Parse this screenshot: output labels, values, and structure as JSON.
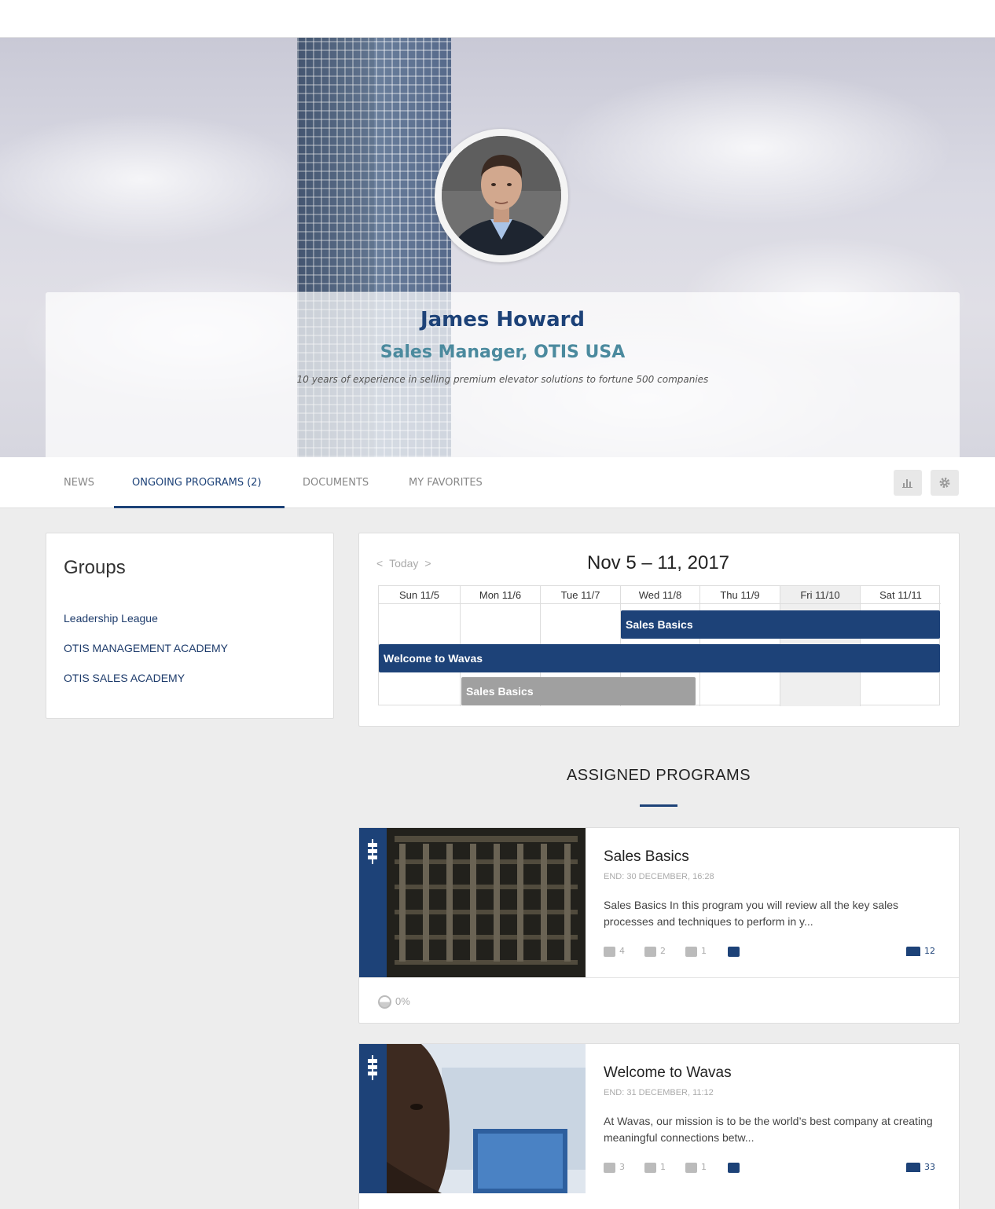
{
  "profile": {
    "name": "James Howard",
    "role": "Sales Manager, OTIS USA",
    "bio": "10 years of experience in selling premium elevator solutions to fortune 500 companies"
  },
  "tabs": [
    {
      "label": "NEWS"
    },
    {
      "label": "ONGOING PROGRAMS (2)",
      "active": true
    },
    {
      "label": "DOCUMENTS"
    },
    {
      "label": "MY FAVORITES"
    }
  ],
  "toolbar": {
    "stats_icon": "bar-chart-icon",
    "settings_icon": "gear-icon"
  },
  "groups": {
    "title": "Groups",
    "items": [
      "Leadership League",
      "OTIS MANAGEMENT ACADEMY",
      "OTIS SALES ACADEMY"
    ]
  },
  "calendar": {
    "prev": "<",
    "today_label": "Today",
    "next": ">",
    "title": "Nov 5 – 11, 2017",
    "days": [
      "Sun 11/5",
      "Mon 11/6",
      "Tue 11/7",
      "Wed 11/8",
      "Thu 11/9",
      "Fri 11/10",
      "Sat 11/11"
    ],
    "highlighted_day": "Fri 11/10",
    "events": [
      {
        "label": "Sales Basics",
        "start_day": "Wed 11/8",
        "end_day": "Sat 11/11",
        "color": "#1d4278"
      },
      {
        "label": "Welcome to Wavas",
        "start_day": "Sun 11/5",
        "end_day": "Sat 11/11",
        "color": "#1d4278"
      },
      {
        "label": "Sales Basics",
        "start_day": "Mon 11/6",
        "end_day": "Thu 11/9",
        "color": "#a0a0a0"
      }
    ]
  },
  "assigned": {
    "title": "ASSIGNED PROGRAMS",
    "programs": [
      {
        "title": "Sales Basics",
        "end": "END: 30 DECEMBER, 16:28",
        "description": "Sales Basics In this program you will review all the key sales processes and techniques to perform in y...",
        "stats": {
          "modules": "4",
          "sessions": "2",
          "videos": "1"
        },
        "enrolled": "12",
        "progress": "0%"
      },
      {
        "title": "Welcome to Wavas",
        "end": "END: 31 DECEMBER, 11:12",
        "description": "At Wavas, our mission is to be the world’s best company at creating meaningful connections betw...",
        "stats": {
          "modules": "3",
          "sessions": "1",
          "videos": "1"
        },
        "enrolled": "33"
      }
    ]
  },
  "colors": {
    "brand": "#1d4278",
    "role": "#4b8a9e",
    "event_gray": "#a0a0a0"
  }
}
